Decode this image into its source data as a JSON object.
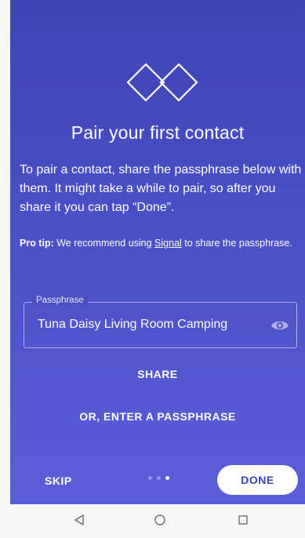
{
  "onboarding": {
    "title": "Pair your first contact",
    "body": "To pair a contact, share the passphrase below with them. It might take a while to pair, so after you share it you can tap “Done”.",
    "tip_bold": "Pro tip:",
    "tip_before_link": " We recommend using ",
    "tip_link": "Signal",
    "tip_after_link": " to share the passphrase."
  },
  "passphrase": {
    "label": "Passphrase",
    "value": "Tuna Daisy Living Room Camping",
    "visibility_icon": "eye-icon"
  },
  "actions": {
    "share_label": "SHARE",
    "enter_passphrase_label": "OR, ENTER A PASSPHRASE",
    "skip_label": "SKIP",
    "done_label": "DONE"
  },
  "pager": {
    "total": 3,
    "current": 3
  },
  "navbar": {
    "icons": [
      "back-triangle-icon",
      "home-circle-icon",
      "recents-square-icon"
    ]
  },
  "colors": {
    "gradient_top": "#3d44b4",
    "gradient_bottom": "#5a5ed8",
    "done_text": "#3b42b0"
  }
}
